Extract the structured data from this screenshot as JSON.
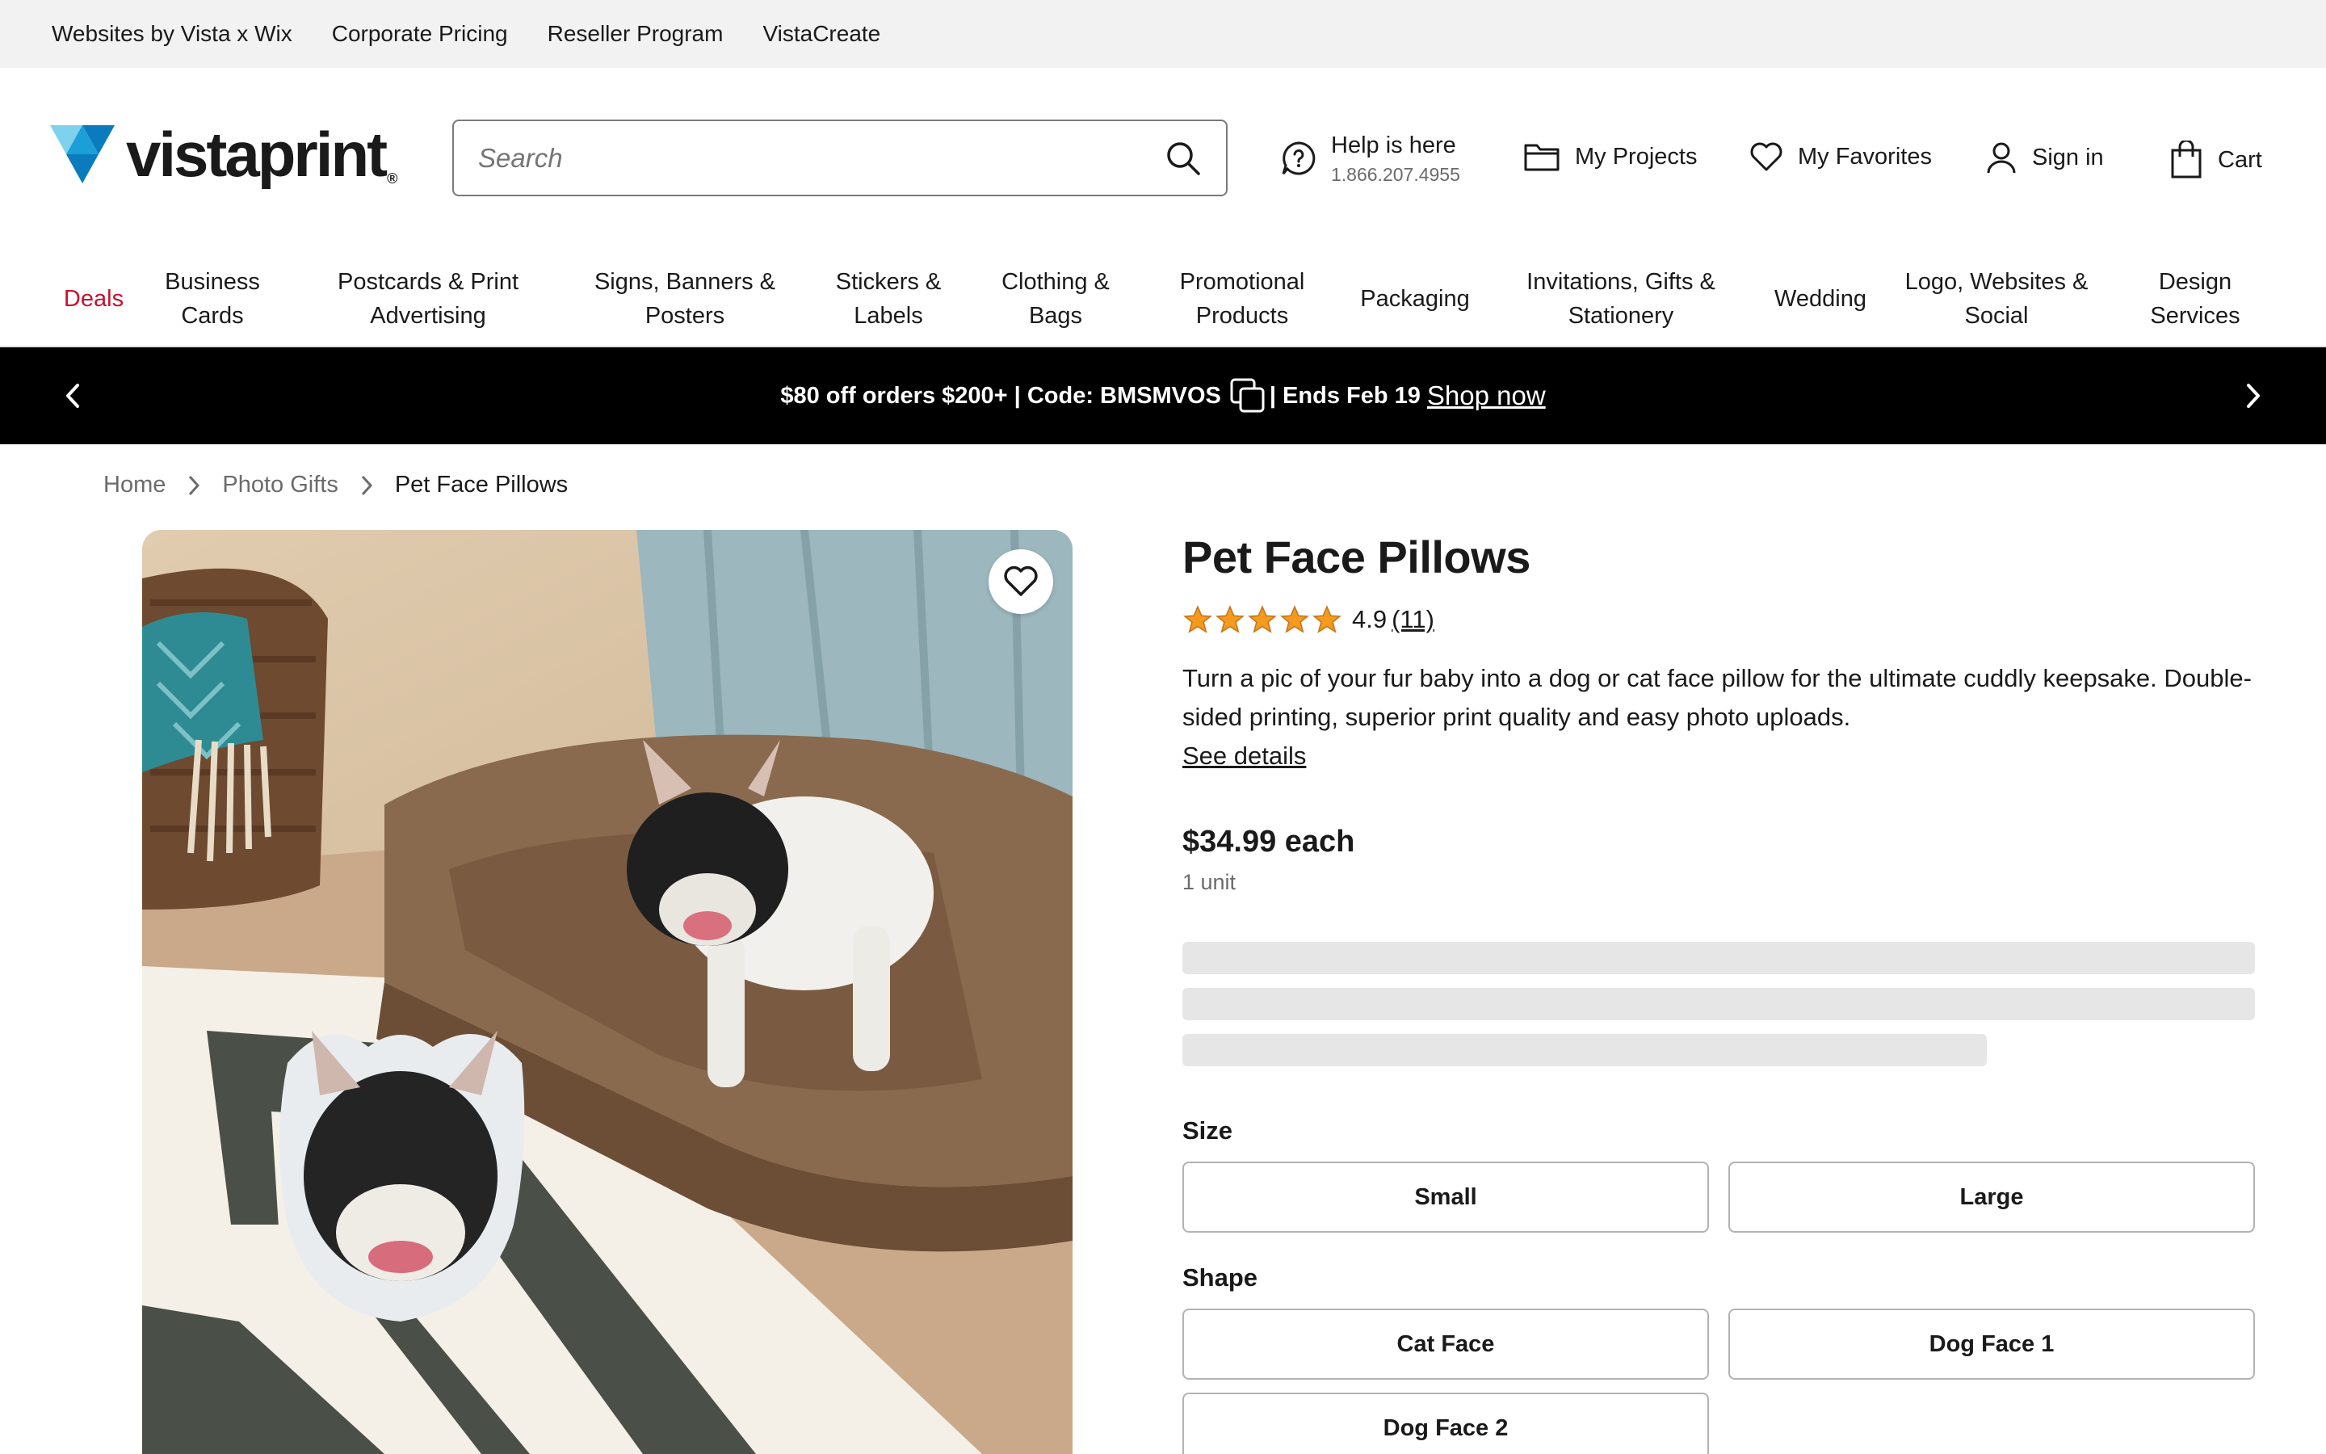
{
  "utility_links": [
    "Websites by Vista x Wix",
    "Corporate Pricing",
    "Reseller Program",
    "VistaCreate"
  ],
  "brand": {
    "name": "vistaprint",
    "accent_colors": [
      "#0a7bbd",
      "#1b9fd8",
      "#7fd1ee"
    ]
  },
  "search": {
    "placeholder": "Search"
  },
  "help": {
    "title": "Help is here",
    "phone": "1.866.207.4955"
  },
  "header_links": {
    "projects": "My Projects",
    "favorites": "My Favorites",
    "sign_in": "Sign in",
    "cart": "Cart"
  },
  "nav": {
    "deals": "Deals",
    "items": [
      "Business\nCards",
      "Postcards & Print\nAdvertising",
      "Signs, Banners &\nPosters",
      "Stickers &\nLabels",
      "Clothing &\nBags",
      "Promotional\nProducts",
      "Packaging",
      "Invitations, Gifts &\nStationery",
      "Wedding",
      "Logo, Websites &\nSocial",
      "Design\nServices"
    ],
    "deals_color": "#c8102e"
  },
  "promo": {
    "offer": "$80 off orders $200+ | Code: BMSMVOS",
    "ends": "| Ends Feb 19",
    "link": "Shop now"
  },
  "breadcrumb": {
    "home": "Home",
    "category": "Photo Gifts",
    "current": "Pet Face Pillows"
  },
  "product": {
    "title": "Pet Face Pillows",
    "rating_value": "4.9",
    "rating_count": "(11)",
    "stars": 5,
    "description": "Turn a pic of your fur baby into a dog or cat face pillow for the ultimate cuddly keepsake. Double-sided printing, superior print quality and easy photo uploads.",
    "see_details": "See details",
    "price": "$34.99 each",
    "unit": "1 unit"
  },
  "options": {
    "size_label": "Size",
    "sizes": [
      "Small",
      "Large"
    ],
    "shape_label": "Shape",
    "shapes": [
      "Cat Face",
      "Dog Face 1",
      "Dog Face 2"
    ]
  }
}
